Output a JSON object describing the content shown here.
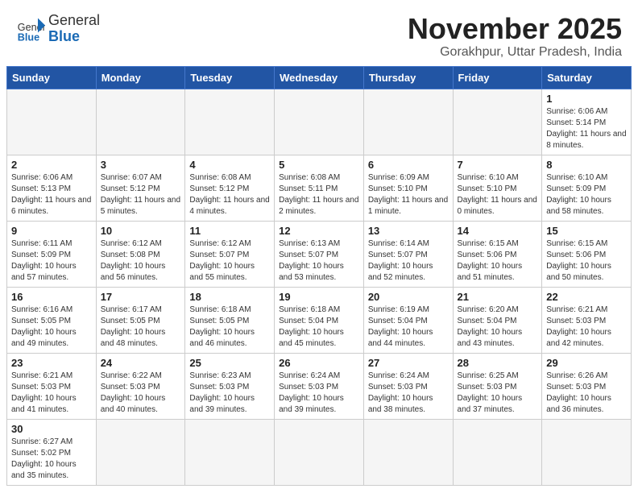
{
  "header": {
    "logo_general": "General",
    "logo_blue": "Blue",
    "month": "November 2025",
    "location": "Gorakhpur, Uttar Pradesh, India"
  },
  "days_of_week": [
    "Sunday",
    "Monday",
    "Tuesday",
    "Wednesday",
    "Thursday",
    "Friday",
    "Saturday"
  ],
  "weeks": [
    [
      {
        "day": "",
        "empty": true
      },
      {
        "day": "",
        "empty": true
      },
      {
        "day": "",
        "empty": true
      },
      {
        "day": "",
        "empty": true
      },
      {
        "day": "",
        "empty": true
      },
      {
        "day": "",
        "empty": true
      },
      {
        "day": "1",
        "sunrise": "6:06 AM",
        "sunset": "5:14 PM",
        "daylight": "11 hours and 8 minutes."
      }
    ],
    [
      {
        "day": "2",
        "sunrise": "6:06 AM",
        "sunset": "5:13 PM",
        "daylight": "11 hours and 6 minutes."
      },
      {
        "day": "3",
        "sunrise": "6:07 AM",
        "sunset": "5:12 PM",
        "daylight": "11 hours and 5 minutes."
      },
      {
        "day": "4",
        "sunrise": "6:08 AM",
        "sunset": "5:12 PM",
        "daylight": "11 hours and 4 minutes."
      },
      {
        "day": "5",
        "sunrise": "6:08 AM",
        "sunset": "5:11 PM",
        "daylight": "11 hours and 2 minutes."
      },
      {
        "day": "6",
        "sunrise": "6:09 AM",
        "sunset": "5:10 PM",
        "daylight": "11 hours and 1 minute."
      },
      {
        "day": "7",
        "sunrise": "6:10 AM",
        "sunset": "5:10 PM",
        "daylight": "11 hours and 0 minutes."
      },
      {
        "day": "8",
        "sunrise": "6:10 AM",
        "sunset": "5:09 PM",
        "daylight": "10 hours and 58 minutes."
      }
    ],
    [
      {
        "day": "9",
        "sunrise": "6:11 AM",
        "sunset": "5:09 PM",
        "daylight": "10 hours and 57 minutes."
      },
      {
        "day": "10",
        "sunrise": "6:12 AM",
        "sunset": "5:08 PM",
        "daylight": "10 hours and 56 minutes."
      },
      {
        "day": "11",
        "sunrise": "6:12 AM",
        "sunset": "5:07 PM",
        "daylight": "10 hours and 55 minutes."
      },
      {
        "day": "12",
        "sunrise": "6:13 AM",
        "sunset": "5:07 PM",
        "daylight": "10 hours and 53 minutes."
      },
      {
        "day": "13",
        "sunrise": "6:14 AM",
        "sunset": "5:07 PM",
        "daylight": "10 hours and 52 minutes."
      },
      {
        "day": "14",
        "sunrise": "6:15 AM",
        "sunset": "5:06 PM",
        "daylight": "10 hours and 51 minutes."
      },
      {
        "day": "15",
        "sunrise": "6:15 AM",
        "sunset": "5:06 PM",
        "daylight": "10 hours and 50 minutes."
      }
    ],
    [
      {
        "day": "16",
        "sunrise": "6:16 AM",
        "sunset": "5:05 PM",
        "daylight": "10 hours and 49 minutes."
      },
      {
        "day": "17",
        "sunrise": "6:17 AM",
        "sunset": "5:05 PM",
        "daylight": "10 hours and 48 minutes."
      },
      {
        "day": "18",
        "sunrise": "6:18 AM",
        "sunset": "5:05 PM",
        "daylight": "10 hours and 46 minutes."
      },
      {
        "day": "19",
        "sunrise": "6:18 AM",
        "sunset": "5:04 PM",
        "daylight": "10 hours and 45 minutes."
      },
      {
        "day": "20",
        "sunrise": "6:19 AM",
        "sunset": "5:04 PM",
        "daylight": "10 hours and 44 minutes."
      },
      {
        "day": "21",
        "sunrise": "6:20 AM",
        "sunset": "5:04 PM",
        "daylight": "10 hours and 43 minutes."
      },
      {
        "day": "22",
        "sunrise": "6:21 AM",
        "sunset": "5:03 PM",
        "daylight": "10 hours and 42 minutes."
      }
    ],
    [
      {
        "day": "23",
        "sunrise": "6:21 AM",
        "sunset": "5:03 PM",
        "daylight": "10 hours and 41 minutes."
      },
      {
        "day": "24",
        "sunrise": "6:22 AM",
        "sunset": "5:03 PM",
        "daylight": "10 hours and 40 minutes."
      },
      {
        "day": "25",
        "sunrise": "6:23 AM",
        "sunset": "5:03 PM",
        "daylight": "10 hours and 39 minutes."
      },
      {
        "day": "26",
        "sunrise": "6:24 AM",
        "sunset": "5:03 PM",
        "daylight": "10 hours and 39 minutes."
      },
      {
        "day": "27",
        "sunrise": "6:24 AM",
        "sunset": "5:03 PM",
        "daylight": "10 hours and 38 minutes."
      },
      {
        "day": "28",
        "sunrise": "6:25 AM",
        "sunset": "5:03 PM",
        "daylight": "10 hours and 37 minutes."
      },
      {
        "day": "29",
        "sunrise": "6:26 AM",
        "sunset": "5:03 PM",
        "daylight": "10 hours and 36 minutes."
      }
    ],
    [
      {
        "day": "30",
        "sunrise": "6:27 AM",
        "sunset": "5:02 PM",
        "daylight": "10 hours and 35 minutes."
      },
      {
        "day": "",
        "empty": true
      },
      {
        "day": "",
        "empty": true
      },
      {
        "day": "",
        "empty": true
      },
      {
        "day": "",
        "empty": true
      },
      {
        "day": "",
        "empty": true
      },
      {
        "day": "",
        "empty": true
      }
    ]
  ]
}
